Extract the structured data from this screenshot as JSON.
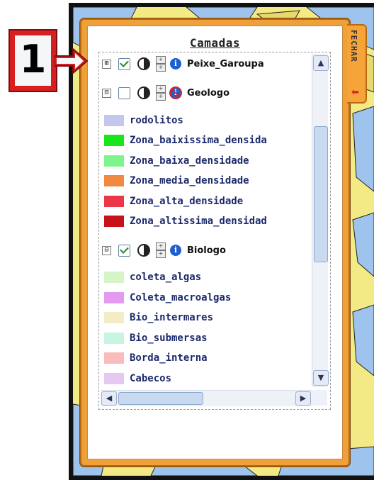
{
  "callout": {
    "number": "1"
  },
  "panel": {
    "title": "Camadas",
    "close_tab": {
      "label": "FECHAR",
      "icon": "arrow-left-icon"
    }
  },
  "layers": [
    {
      "name": "Peixe_Garoupa",
      "expanded": false,
      "expander_symbol": "⊞",
      "checked": true,
      "info_icon": "info-icon"
    },
    {
      "name": "Geologo",
      "expanded": true,
      "expander_symbol": "⊟",
      "checked": false,
      "info_icon": "info-disabled-icon"
    },
    {
      "name": "Biologo",
      "expanded": true,
      "expander_symbol": "⊟",
      "checked": true,
      "info_icon": "info-icon"
    }
  ],
  "geologo_legend": [
    {
      "label": "rodolitos",
      "color": "#c3c7ef"
    },
    {
      "label": "Zona_baixissima_densida",
      "color": "#19e619"
    },
    {
      "label": "Zona_baixa_densidade",
      "color": "#7ef58c"
    },
    {
      "label": "Zona_media_densidade",
      "color": "#f08a40"
    },
    {
      "label": "Zona_alta_densidade",
      "color": "#ec3846"
    },
    {
      "label": "Zona_altissima_densidad",
      "color": "#c8121b"
    }
  ],
  "biologo_legend": [
    {
      "label": "coleta_algas",
      "color": "#d5f5c6"
    },
    {
      "label": "Coleta_macroalgas",
      "color": "#e39bef"
    },
    {
      "label": "Bio_intermares",
      "color": "#f3ecc4"
    },
    {
      "label": "Bio_submersas",
      "color": "#c8f5e2"
    },
    {
      "label": "Borda_interna",
      "color": "#f8bcbc"
    },
    {
      "label": "Cabecos",
      "color": "#e5c8ef"
    }
  ],
  "scrollbars": {
    "up": "▲",
    "down": "▼",
    "left": "◀",
    "right": "▶"
  },
  "colors": {
    "panel_orange": "#f0a038",
    "callout_red": "#d81f1f",
    "map_yellow": "#f3ea86",
    "map_blue": "#9ec3ec"
  }
}
